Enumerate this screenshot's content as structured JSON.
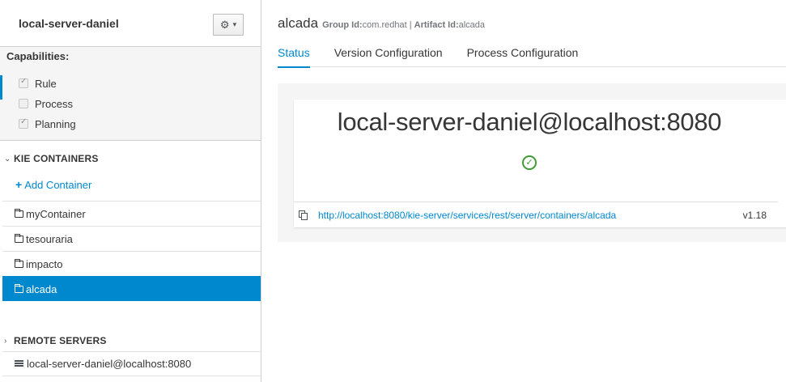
{
  "sidebar": {
    "server_name": "local-server-daniel",
    "settings_icon": "gear-icon",
    "capabilities": {
      "title": "Capabilities:",
      "items": [
        {
          "label": "Rule",
          "checked": true
        },
        {
          "label": "Process",
          "checked": false
        },
        {
          "label": "Planning",
          "checked": true
        }
      ]
    },
    "kie_containers": {
      "title": "KIE CONTAINERS",
      "add_label": "Add Container",
      "items": [
        {
          "label": "myContainer",
          "selected": false
        },
        {
          "label": "tesouraria",
          "selected": false
        },
        {
          "label": "impacto",
          "selected": false
        },
        {
          "label": "alcada",
          "selected": true
        }
      ]
    },
    "remote_servers": {
      "title": "REMOTE SERVERS",
      "items": [
        {
          "label": "local-server-daniel@localhost:8080"
        }
      ]
    }
  },
  "main": {
    "container_name": "alcada",
    "group_id_label": "Group Id:",
    "group_id": "com.redhat",
    "separator": "|",
    "artifact_id_label": "Artifact Id:",
    "artifact_id": "alcada",
    "tabs": [
      {
        "label": "Status",
        "active": true
      },
      {
        "label": "Version Configuration",
        "active": false
      },
      {
        "label": "Process Configuration",
        "active": false
      }
    ],
    "status": {
      "server": "local-server-daniel@localhost:8080",
      "status_icon": "check-circle-icon",
      "url": "http://localhost:8080/kie-server/services/rest/server/containers/alcada",
      "version": "v1.18"
    }
  },
  "colors": {
    "accent": "#0088ce",
    "success": "#3f9c35",
    "panel_bg": "#f5f5f5"
  }
}
